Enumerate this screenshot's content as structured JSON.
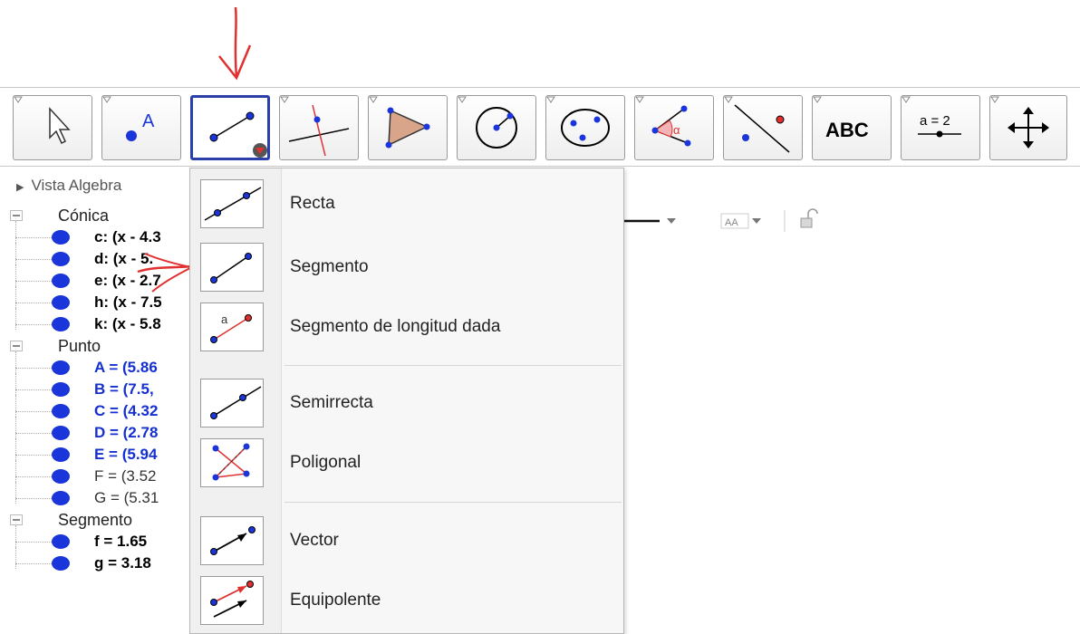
{
  "toolbar": {
    "tools": [
      {
        "name": "move-tool",
        "selected": false
      },
      {
        "name": "point-tool",
        "label": "A",
        "selected": false
      },
      {
        "name": "segment-tool",
        "selected": true
      },
      {
        "name": "perpendicular-line-tool",
        "selected": false
      },
      {
        "name": "polygon-tool",
        "selected": false
      },
      {
        "name": "circle-tool",
        "selected": false
      },
      {
        "name": "ellipse-tool",
        "selected": false
      },
      {
        "name": "angle-tool",
        "label": "α",
        "selected": false
      },
      {
        "name": "reflect-tool",
        "selected": false
      },
      {
        "name": "text-tool",
        "label": "ABC",
        "selected": false
      },
      {
        "name": "slider-tool",
        "label": "a = 2",
        "selected": false
      },
      {
        "name": "move-graphics-view-tool",
        "selected": false
      }
    ]
  },
  "algebra": {
    "header": "Vista Algebra",
    "groups": [
      {
        "name": "Cónica",
        "items": [
          {
            "text": "c: (x - 4.3",
            "style": "black"
          },
          {
            "text": "d: (x - 5.",
            "style": "black"
          },
          {
            "text": "e: (x - 2.7",
            "style": "black"
          },
          {
            "text": "h: (x - 7.5",
            "style": "black"
          },
          {
            "text": "k: (x - 5.8",
            "style": "black"
          }
        ]
      },
      {
        "name": "Punto",
        "items": [
          {
            "text": "A = (5.86",
            "style": "blue"
          },
          {
            "text": "B = (7.5,",
            "style": "blue"
          },
          {
            "text": "C = (4.32",
            "style": "blue"
          },
          {
            "text": "D = (2.78",
            "style": "blue"
          },
          {
            "text": "E = (5.94",
            "style": "blue"
          },
          {
            "text": "F = (3.52",
            "style": "gray"
          },
          {
            "text": "G = (5.31",
            "style": "gray"
          }
        ]
      },
      {
        "name": "Segmento",
        "items": [
          {
            "text": "f = 1.65",
            "style": "black"
          },
          {
            "text": "g = 3.18",
            "style": "black"
          }
        ]
      }
    ]
  },
  "stylebar": {
    "font_size_label": "AA"
  },
  "menu": {
    "items": [
      {
        "label": "Recta",
        "icon": "line-icon"
      },
      {
        "label": "Segmento",
        "icon": "segment-icon"
      },
      {
        "label": "Segmento de longitud dada",
        "icon": "segment-fixed-length-icon",
        "icon_text": "a"
      },
      {
        "label": "Semirrecta",
        "icon": "ray-icon"
      },
      {
        "label": "Poligonal",
        "icon": "polyline-icon"
      },
      {
        "label": "Vector",
        "icon": "vector-icon"
      },
      {
        "label": "Equipolente",
        "icon": "vector-from-point-icon"
      }
    ]
  },
  "colors": {
    "point_blue": "#1a35d9",
    "selected_border": "#2a3fa8",
    "annotation_red": "#e03030"
  }
}
